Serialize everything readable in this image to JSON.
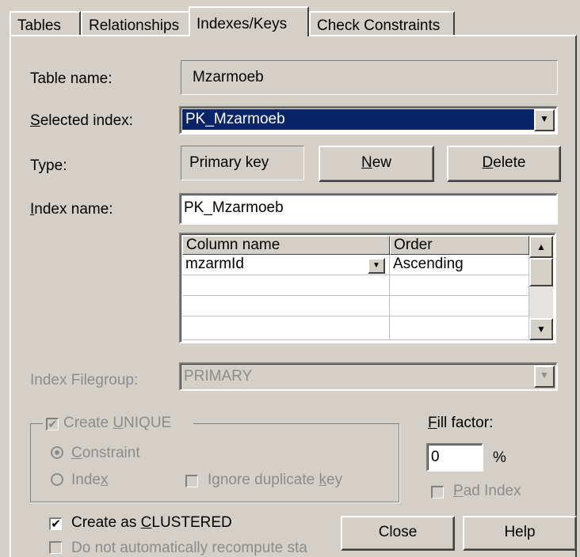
{
  "tabs": [
    {
      "label": "Tables"
    },
    {
      "label": "Relationships"
    },
    {
      "label": "Indexes/Keys"
    },
    {
      "label": "Check Constraints"
    }
  ],
  "form": {
    "table_name_label": "Table name:",
    "table_name_value": "Mzarmoeb",
    "selected_index_label_u": "S",
    "selected_index_label_rest": "elected index:",
    "selected_index_value": "PK_Mzarmoeb",
    "type_label": "Type:",
    "type_value": "Primary key",
    "new_button_u": "N",
    "new_button_rest": "ew",
    "delete_button_u": "D",
    "delete_button_rest": "elete",
    "index_name_label_u": "I",
    "index_name_label_rest": "ndex name:",
    "index_name_value": "PK_Mzarmoeb"
  },
  "columns_grid": {
    "headers": [
      "Column name",
      "Order"
    ],
    "rows": [
      {
        "column": "mzarmId",
        "order": "Ascending"
      }
    ]
  },
  "filegroup": {
    "label": "Index Filegroup:",
    "value": "PRIMARY"
  },
  "unique_group": {
    "create_unique_pre": "Create ",
    "create_unique_u": "U",
    "create_unique_post": "NIQUE",
    "constraint_u": "C",
    "constraint_rest": "onstraint",
    "index_pre": "Inde",
    "index_u": "x",
    "ignore_pre": "Ignore duplicate ",
    "ignore_u": "k",
    "ignore_post": "ey"
  },
  "fill_factor": {
    "label_u": "F",
    "label_rest": "ill factor:",
    "value": "0",
    "unit": "%",
    "pad_u": "P",
    "pad_rest": "ad Index"
  },
  "clustered": {
    "pre": "Create as ",
    "u": "C",
    "post": "LUSTERED",
    "recompute_text": "Do not automatically recompute sta"
  },
  "buttons": {
    "close": "Close",
    "help": "Help"
  },
  "colors": {
    "face": "#d4d0c8",
    "selection": "#0a246a",
    "disabled_text": "#8c8c8c"
  },
  "icons": {
    "dropdown": "triangle-down",
    "scroll_up": "triangle-up",
    "checkmark": "check"
  }
}
